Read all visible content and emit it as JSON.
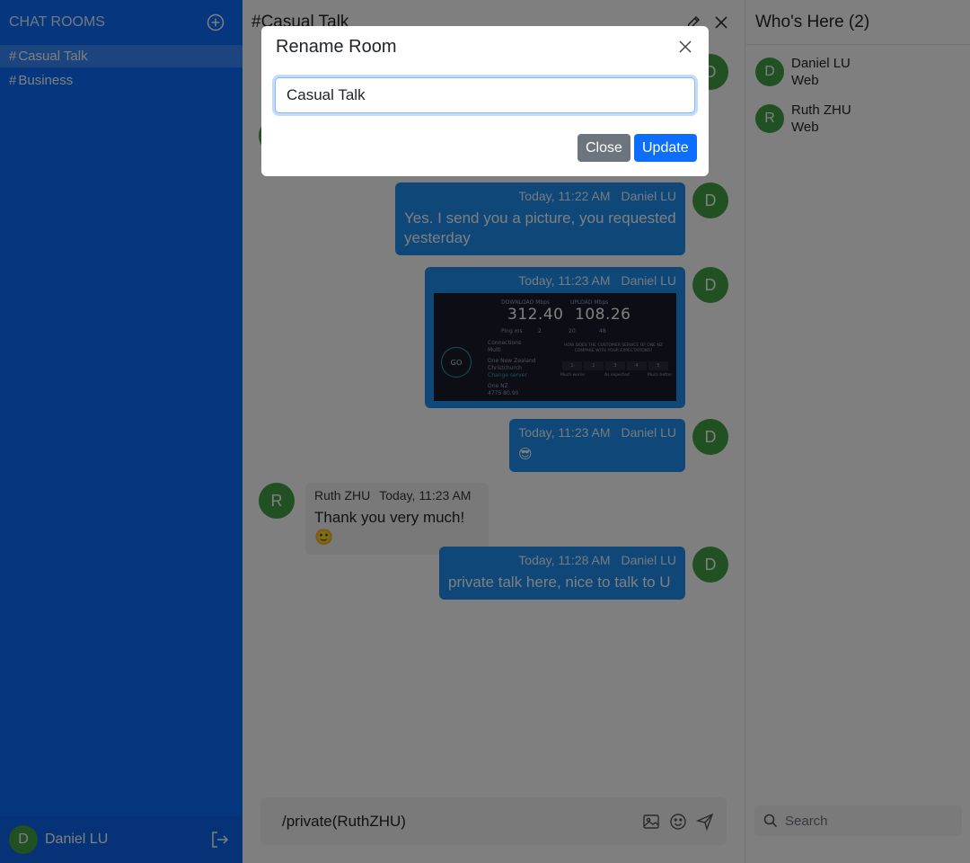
{
  "sidebar": {
    "title": "CHAT ROOMS",
    "add_icon": "plus-circle-icon",
    "rooms": [
      {
        "hash": "#",
        "label": "Casual Talk",
        "active": true
      },
      {
        "hash": "#",
        "label": "Business",
        "active": false
      }
    ],
    "current_user": {
      "initial": "D",
      "name": "Daniel LU"
    },
    "logout_icon": "logout-icon"
  },
  "chat": {
    "title": "#Casual Talk",
    "edit_icon": "pencil-icon",
    "close_icon": "close-icon",
    "messages": [
      {
        "direction": "out",
        "time": "Today, 11:22 AM",
        "author": "Daniel LU",
        "initial": "D",
        "text": "Yes. I send you a picture, you requested yesterday"
      },
      {
        "direction": "out",
        "time": "Today, 11:23 AM",
        "author": "Daniel LU",
        "initial": "D",
        "image": {
          "download_label": "DOWNLOAD Mbps",
          "download_value": "312.40",
          "upload_label": "UPLOAD Mbps",
          "upload_value": "108.26",
          "ping_label": "Ping ms",
          "ping_vals": [
            "2",
            "20",
            "48"
          ],
          "go_label": "GO",
          "connections_label": "Connections",
          "connections_value": "Multi",
          "isp_label": "One New Zealand",
          "isp_location": "Christchurch",
          "isp_change": "Change server",
          "host_label": "One NZ",
          "host_ip": "4775 80.90",
          "survey_question": "HOW DOES THE CUSTOMER SERVICE OF ONE NZ COMPARE WITH YOUR EXPECTATIONS?",
          "survey_options": [
            "1",
            "2",
            "3",
            "4",
            "5"
          ],
          "survey_low": "Much worse",
          "survey_mid": "As expected",
          "survey_high": "Much better"
        }
      },
      {
        "direction": "out",
        "time": "Today, 11:23 AM",
        "author": "Daniel LU",
        "initial": "D",
        "text": "😎"
      },
      {
        "direction": "in",
        "time": "Today, 11:23 AM",
        "author": "Ruth ZHU",
        "initial": "R",
        "text": "Thank you very much!🙂"
      },
      {
        "direction": "out",
        "time": "Today, 11:28 AM",
        "author": "Daniel LU",
        "initial": "D",
        "text": "private talk here, nice to talk to U"
      }
    ],
    "composer": {
      "value": "/private(RuthZHU)",
      "image_icon": "image-icon",
      "emoji_icon": "smiley-icon",
      "send_icon": "send-icon"
    }
  },
  "presence": {
    "title": "Who's Here (2)",
    "members": [
      {
        "initial": "D",
        "name": "Daniel LU",
        "client": "Web"
      },
      {
        "initial": "R",
        "name": "Ruth ZHU",
        "client": "Web"
      }
    ],
    "search_placeholder": "Search",
    "search_icon": "search-icon"
  },
  "modal": {
    "title": "Rename Room",
    "input_value": "Casual Talk",
    "close_label": "Close",
    "update_label": "Update",
    "dismiss_icon": "close-icon"
  },
  "colors": {
    "sidebar": "#0d6efd",
    "bubble_out": "#1d8ff0",
    "avatar": "#43a047",
    "btn_secondary": "#6c757d",
    "btn_primary": "#0d6efd"
  }
}
